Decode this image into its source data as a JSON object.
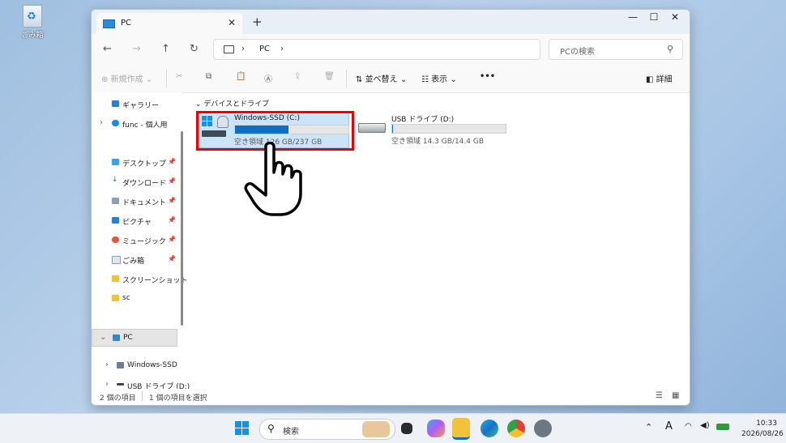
{
  "desktop": {
    "recycle_label": "ごみ箱"
  },
  "window": {
    "tab_title": "PC",
    "address": {
      "crumb": "PC"
    },
    "search": {
      "placeholder": "PCの検索"
    },
    "toolbar": {
      "new_label": "新規作成",
      "sort_label": "並べ替え",
      "view_label": "表示",
      "more_label": "•••",
      "details_label": "詳細"
    },
    "sidebar": {
      "items": [
        {
          "label": "ギャラリー",
          "icon": "gallery-icon"
        },
        {
          "label": "func - 個人用",
          "icon": "cloud-icon"
        },
        {
          "label": "デスクトップ",
          "icon": "desktop-folder-icon"
        },
        {
          "label": "ダウンロード",
          "icon": "download-icon"
        },
        {
          "label": "ドキュメント",
          "icon": "document-icon"
        },
        {
          "label": "ピクチャ",
          "icon": "pictures-icon"
        },
        {
          "label": "ミュージック",
          "icon": "music-icon"
        },
        {
          "label": "ごみ箱",
          "icon": "recycle-bin-icon"
        },
        {
          "label": "スクリーンショット",
          "icon": "folder-icon"
        },
        {
          "label": "sc",
          "icon": "folder-icon"
        },
        {
          "label": "PC",
          "icon": "pc-icon"
        },
        {
          "label": "Windows-SSD",
          "icon": "drive-icon"
        },
        {
          "label": "USB ドライブ (D:)",
          "icon": "usb-drive-icon"
        }
      ]
    },
    "content": {
      "group_label": "デバイスとドライブ",
      "drives": [
        {
          "name": "Windows-SSD (C:)",
          "free_text": "空き領域 126 GB/237 GB",
          "used_fraction": 0.47
        },
        {
          "name": "USB ドライブ (D:)",
          "free_text": "空き領域 14.3 GB/14.4 GB",
          "used_fraction": 0.01
        }
      ]
    },
    "status": {
      "count": "2 個の項目",
      "selected": "1 個の項目を選択"
    }
  },
  "taskbar": {
    "search_placeholder": "検索",
    "time": "10:33",
    "date": "2026/08/26",
    "ime": "A"
  },
  "colors": {
    "accent": "#0e6fc4",
    "highlight_box": "#e00000",
    "selection": "#cce4f7"
  }
}
